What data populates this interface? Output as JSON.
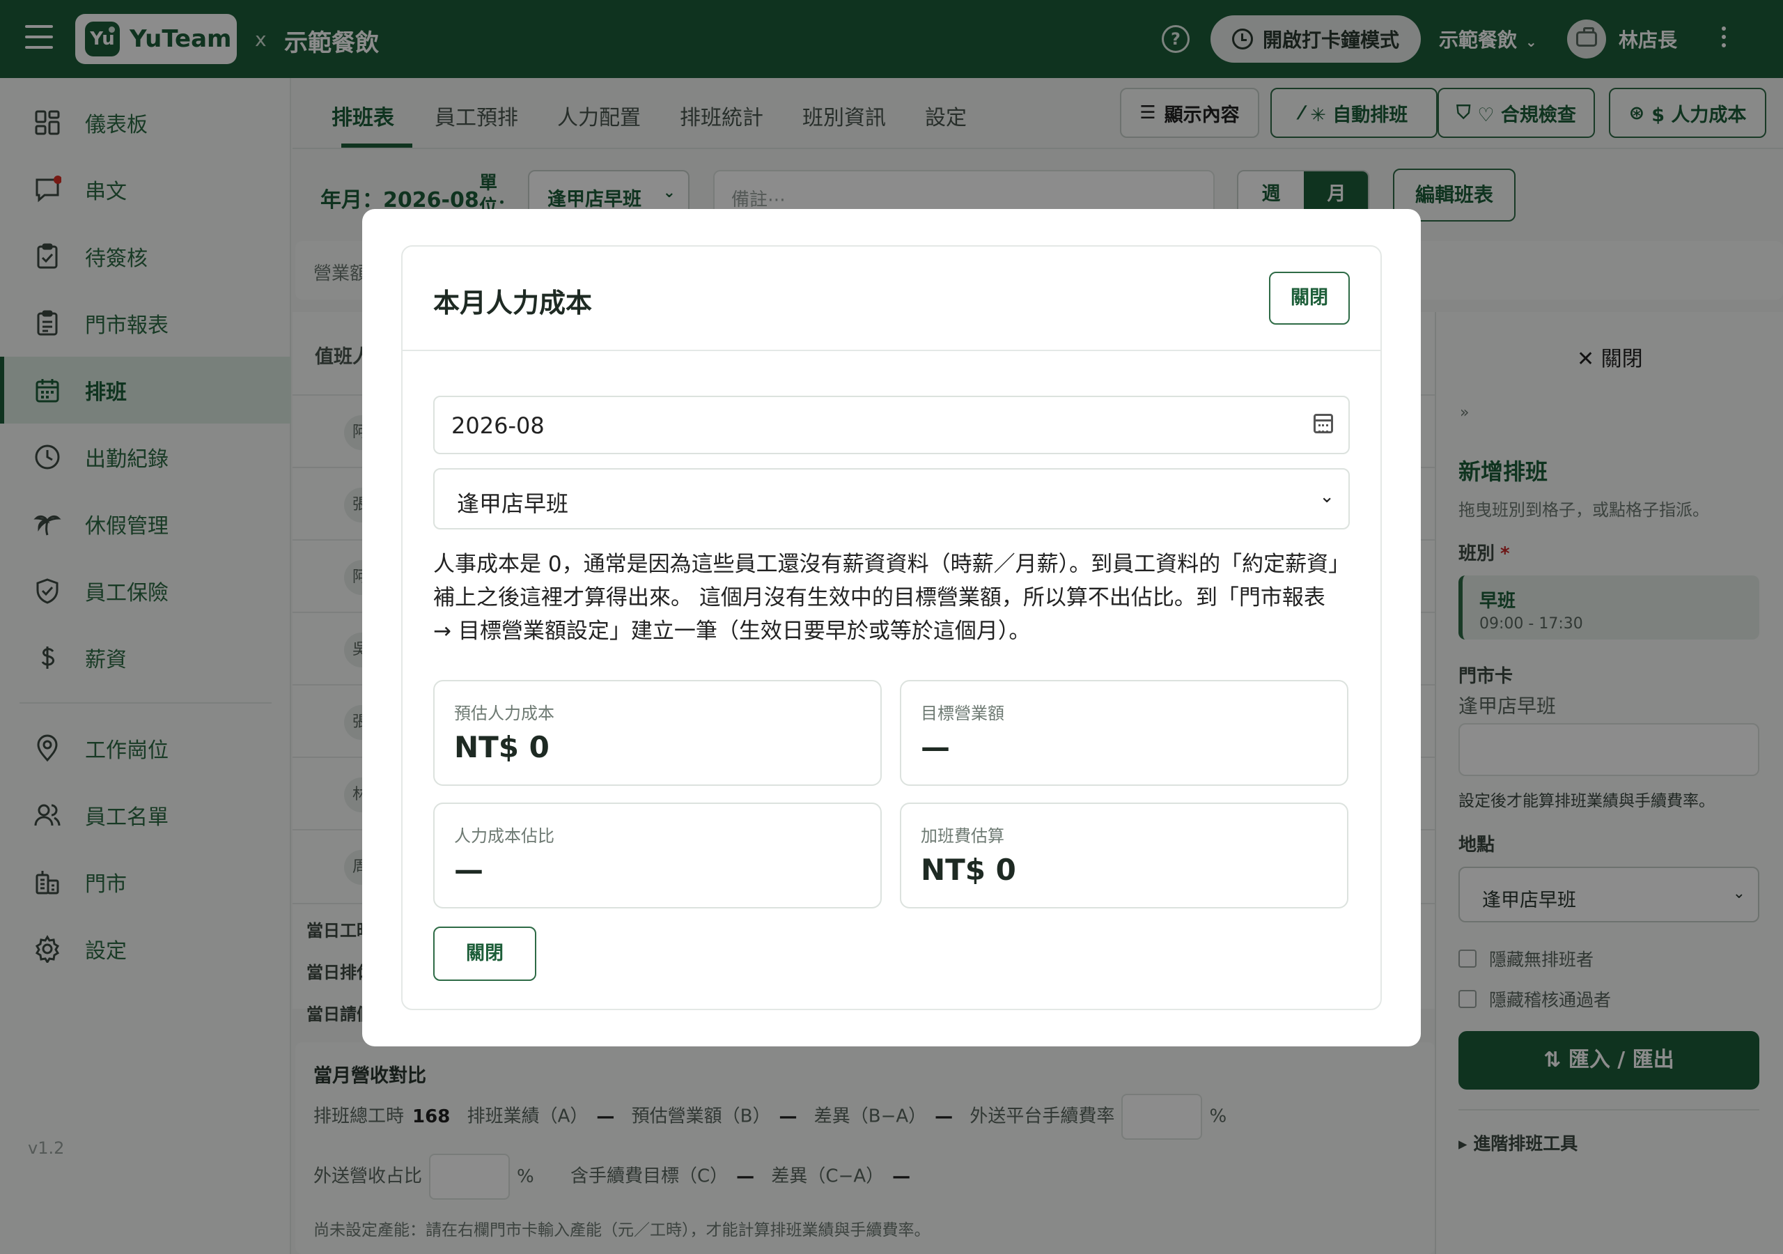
{
  "topbar": {
    "brand_logo": "Yu",
    "brand_name": "YuTeam",
    "separator": "x",
    "company": "示範餐飲",
    "clock_mode_label": "開啟打卡鐘模式",
    "store_selector": "示範餐飲",
    "user_name": "林店長",
    "colors": {
      "primary": "#1d5e39",
      "accent_light": "#dbe9e0"
    }
  },
  "sidebar": {
    "items": [
      {
        "label": "儀表板",
        "icon": "dashboard-icon"
      },
      {
        "label": "串文",
        "icon": "chat-icon",
        "badge": "red-dot"
      },
      {
        "label": "待簽核",
        "icon": "clipboard-check-icon"
      },
      {
        "label": "門市報表",
        "icon": "report-icon"
      },
      {
        "label": "排班",
        "icon": "calendar-icon",
        "active": true
      },
      {
        "label": "出勤紀錄",
        "icon": "clock-icon"
      },
      {
        "label": "休假管理",
        "icon": "palm-tree-icon"
      },
      {
        "label": "員工保險",
        "icon": "shield-icon"
      },
      {
        "label": "薪資",
        "icon": "dollar-icon"
      },
      {
        "label": "工作崗位",
        "icon": "location-pin-icon"
      },
      {
        "label": "員工名單",
        "icon": "users-icon"
      },
      {
        "label": "門市",
        "icon": "store-icon"
      },
      {
        "label": "設定",
        "icon": "gear-icon"
      }
    ],
    "version": "v1.2"
  },
  "tabs": [
    {
      "label": "排班表",
      "active": true
    },
    {
      "label": "員工預排"
    },
    {
      "label": "人力配置"
    },
    {
      "label": "排班統計"
    },
    {
      "label": "班別資訊"
    },
    {
      "label": "設定"
    }
  ],
  "toolbar": {
    "display_content": "顯示內容",
    "auto_schedule": "✳ 自動排班",
    "compliance_check": "♡ 合規檢查",
    "labor_cost": "$ 人力成本",
    "year_month": "年月：2026-08",
    "unit_label": "單位：",
    "unit_value": "逢甲店早班",
    "note_placeholder": "備註⋯",
    "view_week": "週",
    "view_month": "月",
    "edit_schedule": "編輯班表"
  },
  "background": {
    "revenue_label": "營業額",
    "grid_header": "值班人",
    "row_chips": [
      "阿",
      "張",
      "阿",
      "吳",
      "張",
      "林",
      "周"
    ],
    "day_labels": [
      "當日工時",
      "當日排休",
      "當日請假"
    ],
    "month_compare": {
      "title": "當月營收對比",
      "total_hours_label": "排班總工時",
      "total_hours_value": "168",
      "schedule_perf_label": "排班業績（A）",
      "schedule_perf_value": "—",
      "est_revenue_label": "預估營業額（B）",
      "est_revenue_value": "—",
      "diff_ba_label": "差異（B−A）",
      "diff_ba_value": "—",
      "platform_fee_label": "外送平台手續費率",
      "percent": "%",
      "delivery_share_label": "外送營收占比",
      "fee_target_label": "含手續費目標（C）",
      "fee_target_value": "—",
      "diff_ca_label": "差異（C−A）",
      "diff_ca_value": "—",
      "note": "尚未設定產能：請在右欄門市卡輸入產能（元／工時），才能計算排班業績與手續費率。"
    }
  },
  "right_panel": {
    "close_label": "✕ 關閉",
    "collapse": "»",
    "title": "新增排班",
    "subtitle": "拖曳班別到格子，或點格子指派。",
    "shift_label": "班別",
    "required_mark": "*",
    "shift_name": "早班",
    "shift_time": "09:00 - 17:30",
    "store_card_label": "門市卡",
    "store_card_value": "逢甲店早班",
    "store_card_hint": "設定後才能算排班業績與手續費率。",
    "location_label": "地點",
    "location_value": "逢甲店早班",
    "hide_unscheduled": "隱藏無排班者",
    "hide_passed": "隱藏稽核通過者",
    "import_export": "⇅ 匯入 / 匯出",
    "advanced_tools": "▸ 進階排班工具"
  },
  "modal": {
    "title": "本月人力成本",
    "close_label": "關閉",
    "month_value": "2026-08",
    "unit_value": "逢甲店早班",
    "description": "人事成本是 0，通常是因為這些員工還沒有薪資資料（時薪／月薪）。到員工資料的「約定薪資」補上之後這裡才算得出來。 這個月沒有生效中的目標營業額，所以算不出佔比。到「門市報表 → 目標營業額設定」建立一筆（生效日要早於或等於這個月）。",
    "cards": [
      {
        "label": "預估人力成本",
        "value": "NT$ 0"
      },
      {
        "label": "目標營業額",
        "value": "—"
      },
      {
        "label": "人力成本佔比",
        "value": "—"
      },
      {
        "label": "加班費估算",
        "value": "NT$ 0"
      }
    ],
    "close_bottom_label": "關閉"
  }
}
